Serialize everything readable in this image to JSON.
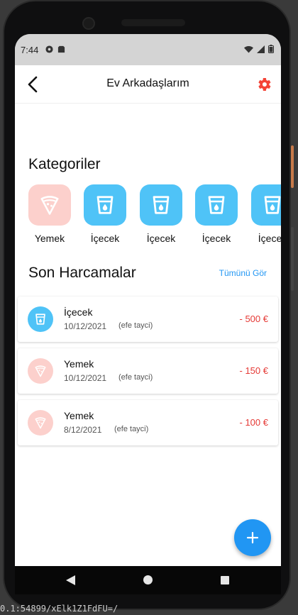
{
  "status": {
    "time": "7:44"
  },
  "appbar": {
    "title": "Ev Arkadaşlarım"
  },
  "categories": {
    "title": "Kategoriler",
    "items": [
      {
        "label": "Yemek",
        "icon": "pizza-icon",
        "bg": "#fcd0cc"
      },
      {
        "label": "İçecek",
        "icon": "cup-icon",
        "bg": "#4fc3f7"
      },
      {
        "label": "İçecek",
        "icon": "cup-icon",
        "bg": "#4fc3f7"
      },
      {
        "label": "İçecek",
        "icon": "cup-icon",
        "bg": "#4fc3f7"
      },
      {
        "label": "İçecek",
        "icon": "cup-icon",
        "bg": "#4fc3f7"
      }
    ]
  },
  "recent": {
    "title": "Son Harcamalar",
    "see_all": "Tümünü Gör",
    "items": [
      {
        "name": "İçecek",
        "date": "10/12/2021",
        "user": "(efe tayci)",
        "amount": "- 500 €",
        "icon": "cup-icon",
        "bg": "#4fc3f7"
      },
      {
        "name": "Yemek",
        "date": "10/12/2021",
        "user": "(efe tayci)",
        "amount": "- 150 €",
        "icon": "pizza-icon",
        "bg": "#fcd0cc"
      },
      {
        "name": "Yemek",
        "date": "8/12/2021",
        "user": "(efe tayci)",
        "amount": "- 100 €",
        "icon": "pizza-icon",
        "bg": "#fcd0cc"
      }
    ]
  },
  "colors": {
    "accent": "#2196f3",
    "negative": "#e53935",
    "settings": "#f44336"
  },
  "terminal": {
    "text": "0.1:54899/xElk1Z1FdFU=/"
  }
}
